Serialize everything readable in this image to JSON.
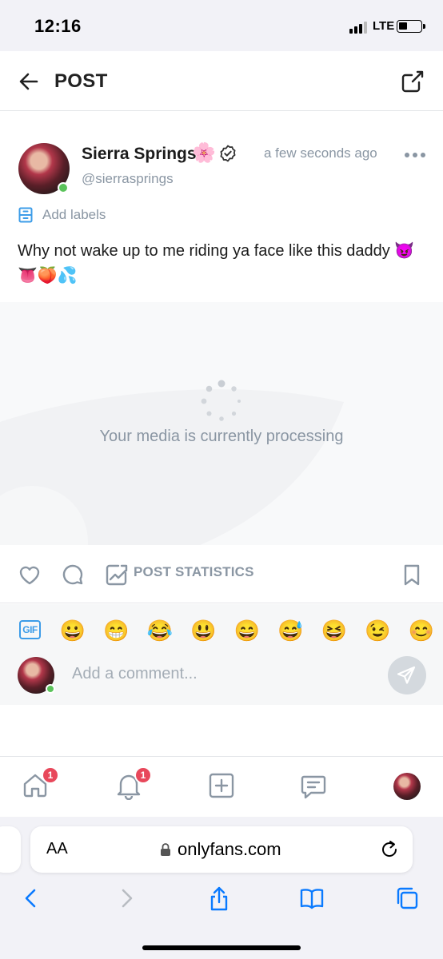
{
  "status_bar": {
    "time": "12:16",
    "network": "LTE"
  },
  "header": {
    "title": "POST"
  },
  "post": {
    "author_name": "Sierra Springs",
    "author_emoji": "🌸",
    "handle": "@sierrasprings",
    "timestamp": "a few seconds ago",
    "add_labels": "Add labels",
    "text": "Why not wake up to me riding ya face like this daddy 😈👅🍑💦"
  },
  "media": {
    "processing_text": "Your media is currently processing"
  },
  "actions": {
    "stats_label": "POST STATISTICS"
  },
  "comment": {
    "gif_label": "GIF",
    "emojis": [
      "😀",
      "😁",
      "😂",
      "😃",
      "😄",
      "😅",
      "😆",
      "😉",
      "😊"
    ],
    "placeholder": "Add a comment..."
  },
  "bottom_nav": {
    "home_badge": "1",
    "notifications_badge": "1"
  },
  "browser": {
    "aa_label": "AA",
    "url": "onlyfans.com"
  },
  "colors": {
    "accent": "#00aff0",
    "muted": "#8a96a3",
    "badge": "#e8485b",
    "online": "#5bc35b"
  }
}
